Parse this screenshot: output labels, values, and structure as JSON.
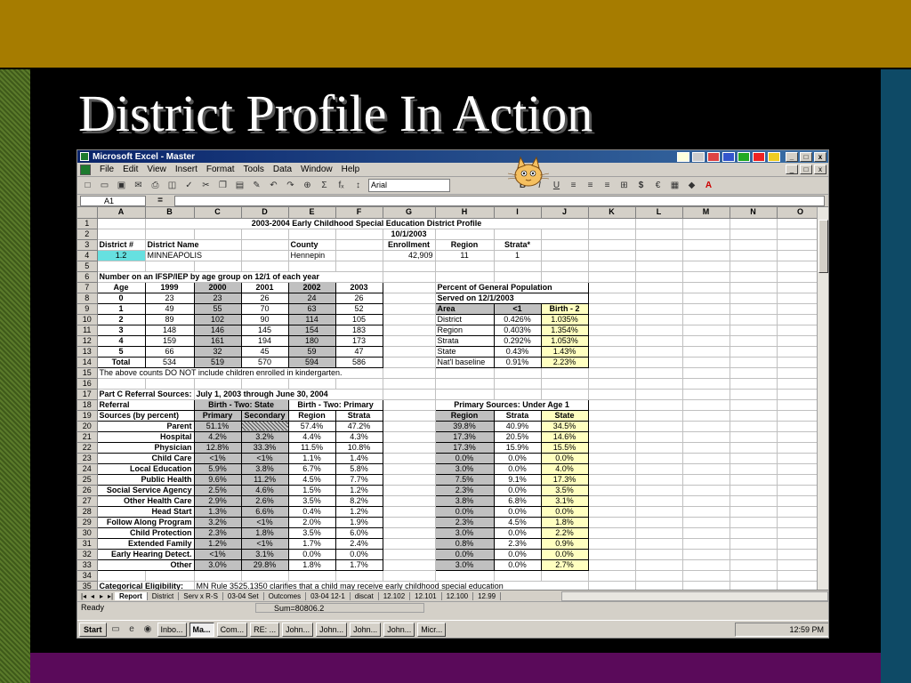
{
  "slide": {
    "title": "District Profile In Action"
  },
  "window": {
    "title": "Microsoft Excel - Master",
    "min": "_",
    "max": "□",
    "close": "x"
  },
  "menu": [
    "File",
    "Edit",
    "View",
    "Insert",
    "Format",
    "Tools",
    "Data",
    "Window",
    "Help"
  ],
  "toolbar": {
    "font": "Arial",
    "bold": "B",
    "italic": "I",
    "underline": "U",
    "sigma": "Σ",
    "fx": "fₓ",
    "currency": "$",
    "euro": "€"
  },
  "formula_bar": {
    "cell": "A1",
    "eq": "="
  },
  "columns": [
    "A",
    "B",
    "C",
    "D",
    "E",
    "F",
    "G",
    "H",
    "I",
    "J",
    "K",
    "L",
    "M",
    "N",
    "O"
  ],
  "rows": {
    "r1": "2003-2004 Early Childhood Special Education District Profile",
    "r2": "10/1/2003",
    "r3": [
      "District #",
      "District Name",
      "County",
      "Enrollment",
      "Region",
      "Strata*"
    ],
    "r4": [
      "1.2",
      "MINNEAPOLIS",
      "Hennepin",
      "42,909",
      "11",
      "1"
    ],
    "r6": "Number on an IFSP/IEP by age group on 12/1 of each year",
    "age_header": [
      "Age",
      "1999",
      "2000",
      "2001",
      "2002",
      "2003"
    ],
    "age_rows": [
      [
        "0",
        "23",
        "23",
        "26",
        "24",
        "26"
      ],
      [
        "1",
        "49",
        "55",
        "70",
        "63",
        "52"
      ],
      [
        "2",
        "89",
        "102",
        "90",
        "114",
        "105"
      ],
      [
        "3",
        "148",
        "146",
        "145",
        "154",
        "183"
      ],
      [
        "4",
        "159",
        "161",
        "194",
        "180",
        "173"
      ],
      [
        "5",
        "66",
        "32",
        "45",
        "59",
        "47"
      ],
      [
        "Total",
        "534",
        "519",
        "570",
        "594",
        "586"
      ]
    ],
    "pct_title1": "Percent of General Population",
    "pct_title2": "Served on 12/1/2003",
    "pct_header": [
      "Area",
      "<1",
      "Birth - 2"
    ],
    "pct_rows": [
      [
        "District",
        "0.426%",
        "1.035%"
      ],
      [
        "Region",
        "0.403%",
        "1.354%"
      ],
      [
        "Strata",
        "0.292%",
        "1.053%"
      ],
      [
        "State",
        "0.43%",
        "1.43%"
      ],
      [
        "Nat'l baseline",
        "0.91%",
        "2.23%"
      ]
    ],
    "r15": "The above counts DO NOT include children enrolled in kindergarten.",
    "r17a": "Part C Referral Sources:",
    "r17b": "July 1, 2003 through June 30, 2004",
    "r18": [
      "Referral",
      "Birth - Two: State",
      "Birth - Two: Primary",
      "Primary Sources:  Under Age 1"
    ],
    "r19": [
      "Sources (by percent)",
      "Primary",
      "Secondary",
      "Region",
      "Strata",
      "Region",
      "Strata",
      "State"
    ],
    "ref_rows": [
      [
        "Parent",
        "51.1%",
        "",
        "57.4%",
        "47.2%",
        "39.8%",
        "40.9%",
        "34.5%"
      ],
      [
        "Hospital",
        "4.2%",
        "3.2%",
        "4.4%",
        "4.3%",
        "17.3%",
        "20.5%",
        "14.6%"
      ],
      [
        "Physician",
        "12.8%",
        "33.3%",
        "11.5%",
        "10.8%",
        "17.3%",
        "15.9%",
        "15.5%"
      ],
      [
        "Child Care",
        "<1%",
        "<1%",
        "1.1%",
        "1.4%",
        "0.0%",
        "0.0%",
        "0.0%"
      ],
      [
        "Local Education",
        "5.9%",
        "3.8%",
        "6.7%",
        "5.8%",
        "3.0%",
        "0.0%",
        "4.0%"
      ],
      [
        "Public Health",
        "9.6%",
        "11.2%",
        "4.5%",
        "7.7%",
        "7.5%",
        "9.1%",
        "17.3%"
      ],
      [
        "Social Service Agency",
        "2.5%",
        "4.6%",
        "1.5%",
        "1.2%",
        "2.3%",
        "0.0%",
        "3.5%"
      ],
      [
        "Other Health Care",
        "2.9%",
        "2.6%",
        "3.5%",
        "8.2%",
        "3.8%",
        "6.8%",
        "3.1%"
      ],
      [
        "Head Start",
        "1.3%",
        "6.6%",
        "0.4%",
        "1.2%",
        "0.0%",
        "0.0%",
        "0.0%"
      ],
      [
        "Follow Along Program",
        "3.2%",
        "<1%",
        "2.0%",
        "1.9%",
        "2.3%",
        "4.5%",
        "1.8%"
      ],
      [
        "Child Protection",
        "2.3%",
        "1.8%",
        "3.5%",
        "6.0%",
        "3.0%",
        "0.0%",
        "2.2%"
      ],
      [
        "Extended Family",
        "1.2%",
        "<1%",
        "1.7%",
        "2.4%",
        "0.8%",
        "2.3%",
        "0.9%"
      ],
      [
        "Early Hearing Detect.",
        "<1%",
        "3.1%",
        "0.0%",
        "0.0%",
        "0.0%",
        "0.0%",
        "0.0%"
      ],
      [
        "Other",
        "3.0%",
        "29.8%",
        "1.8%",
        "1.7%",
        "3.0%",
        "0.0%",
        "2.7%"
      ]
    ],
    "r35a": "Categorical Eligibility:",
    "r35b": "MN Rule 3525.1350 clarifies that a child may receive early childhood special education"
  },
  "sheet_tabs": [
    "Report",
    "District",
    "Serv x R-S",
    "03-04 Set",
    "Outcomes",
    "03-04 12-1",
    "discat",
    "12.102",
    "12.101",
    "12.100",
    "12.99"
  ],
  "status": {
    "ready": "Ready",
    "sum": "Sum=80806.2"
  },
  "taskbar": {
    "start": "Start",
    "tasks": [
      "Inbo...",
      "Ma...",
      "Com...",
      "RE: ...",
      "John...",
      "John...",
      "John...",
      "John...",
      "Micr..."
    ],
    "clock": "12:59 PM"
  }
}
